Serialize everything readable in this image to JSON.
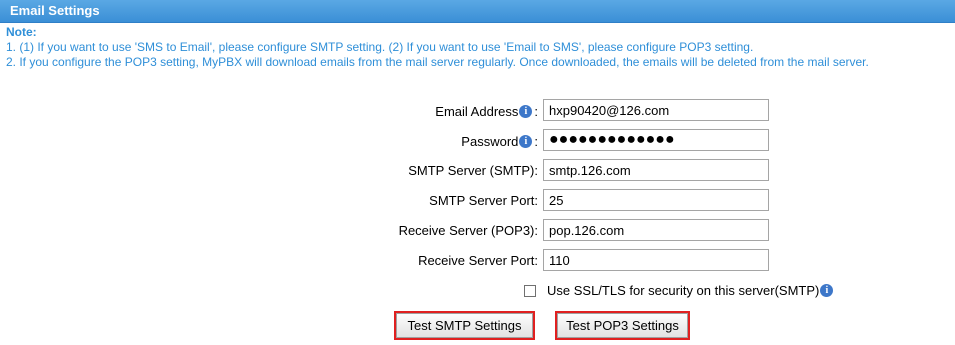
{
  "header": {
    "title": "Email Settings"
  },
  "note": {
    "title": "Note:",
    "lines": [
      "1. (1) If you want to use 'SMS to Email', please configure SMTP setting. (2) If you want to use 'Email to SMS', please configure POP3 setting.",
      "2. If you configure the POP3 setting, MyPBX will download emails from the mail server regularly. Once downloaded, the emails will be deleted from the mail server."
    ]
  },
  "form": {
    "email_label": "Email Address",
    "email_value": "hxp90420@126.com",
    "password_label": "Password",
    "password_value": "●●●●●●●●●●●●●",
    "smtp_server_label": "SMTP Server (SMTP):",
    "smtp_server_value": "smtp.126.com",
    "smtp_port_label": "SMTP Server Port:",
    "smtp_port_value": "25",
    "pop3_server_label": "Receive Server (POP3):",
    "pop3_server_value": "pop.126.com",
    "pop3_port_label": "Receive Server Port:",
    "pop3_port_value": "110",
    "ssl_label": "Use SSL/TLS for security on this server(SMTP)",
    "ssl_checked": false,
    "colon": ":"
  },
  "buttons": {
    "test_smtp": "Test SMTP Settings",
    "test_pop3": "Test POP3 Settings"
  },
  "icons": {
    "info": "info-icon",
    "info_glyph": "i"
  },
  "colors": {
    "header": "#3b8fd6",
    "note_text": "#2f8fd8",
    "highlight_border": "#e02020"
  }
}
